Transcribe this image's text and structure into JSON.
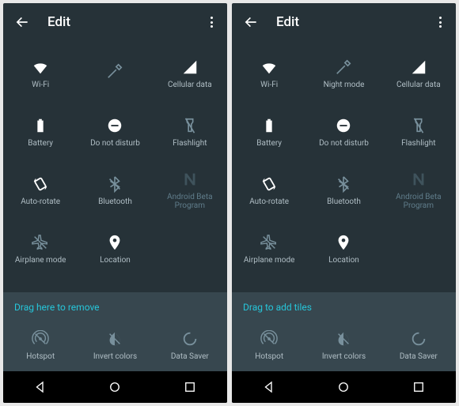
{
  "screens": [
    {
      "header": {
        "title": "Edit"
      },
      "tiles": [
        {
          "icon": "wifi",
          "label": "Wi-Fi",
          "active": true
        },
        {
          "icon": "dropper",
          "label": " ",
          "active": false
        },
        {
          "icon": "signal",
          "label": "Cellular data",
          "active": true
        },
        {
          "icon": "battery",
          "label": "Battery",
          "active": true
        },
        {
          "icon": "dnd",
          "label": "Do not disturb",
          "active": true
        },
        {
          "icon": "flashlight",
          "label": "Flashlight",
          "active": false
        },
        {
          "icon": "rotate",
          "label": "Auto-rotate",
          "active": true
        },
        {
          "icon": "bluetooth",
          "label": "Bluetooth",
          "active": false
        },
        {
          "icon": "nlogo",
          "label": "Android Beta Program",
          "active": false,
          "dim": true
        },
        {
          "icon": "airplane",
          "label": "Airplane mode",
          "active": false
        },
        {
          "icon": "location",
          "label": "Location",
          "active": true
        }
      ],
      "drag_hint": "Drag here to remove",
      "extra": [
        {
          "icon": "hotspot",
          "label": "Hotspot"
        },
        {
          "icon": "invert",
          "label": "Invert colors"
        },
        {
          "icon": "datasaver",
          "label": "Data Saver"
        }
      ]
    },
    {
      "header": {
        "title": "Edit"
      },
      "tiles": [
        {
          "icon": "wifi",
          "label": "Wi-Fi",
          "active": true
        },
        {
          "icon": "dropper",
          "label": "Night mode",
          "active": false
        },
        {
          "icon": "signal",
          "label": "Cellular data",
          "active": true
        },
        {
          "icon": "battery",
          "label": "Battery",
          "active": true
        },
        {
          "icon": "dnd",
          "label": "Do not disturb",
          "active": true
        },
        {
          "icon": "flashlight",
          "label": "Flashlight",
          "active": false
        },
        {
          "icon": "rotate",
          "label": "Auto-rotate",
          "active": true
        },
        {
          "icon": "bluetooth",
          "label": "Bluetooth",
          "active": false
        },
        {
          "icon": "nlogo",
          "label": "Android Beta Program",
          "active": false,
          "dim": true
        },
        {
          "icon": "airplane",
          "label": "Airplane mode",
          "active": false
        },
        {
          "icon": "location",
          "label": "Location",
          "active": true
        }
      ],
      "drag_hint": "Drag to add tiles",
      "extra": [
        {
          "icon": "hotspot",
          "label": "Hotspot"
        },
        {
          "icon": "invert",
          "label": "Invert colors"
        },
        {
          "icon": "datasaver",
          "label": "Data Saver"
        }
      ]
    }
  ]
}
